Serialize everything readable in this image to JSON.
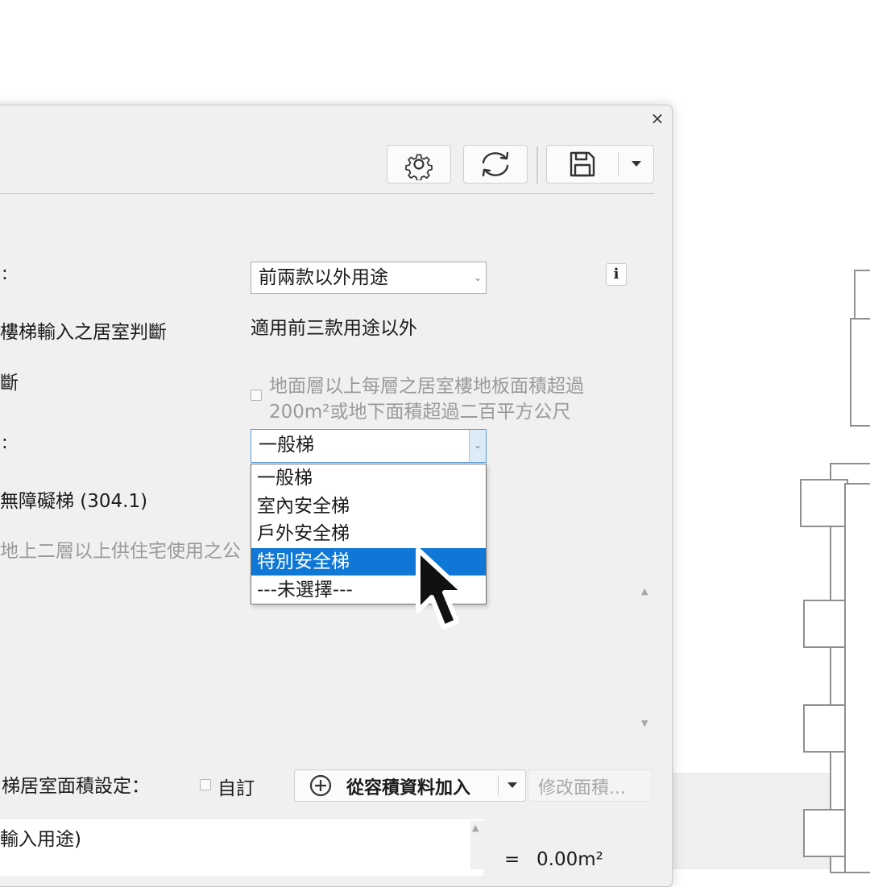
{
  "toolbar": {
    "settings_icon": "gear-icon",
    "refresh_icon": "refresh-icon",
    "save_icon": "save-icon",
    "dropdown_icon": "caret-down-icon",
    "close_label": "×"
  },
  "form": {
    "row1_label": ":",
    "use_select_value": "前兩款以外用途",
    "info_label": "i",
    "row2_label": "樓梯輸入之居室判斷",
    "row2_value": "適用前三款用途以外",
    "row3_label": "斷",
    "area_checkbox_line1": "地面層以上每層之居室樓地板面積超過",
    "area_checkbox_line2": "200m²或地下面積超過二百平方公尺",
    "row4_label": ":",
    "stair_select_value": "一般梯",
    "row5_label": "無障礙梯 (304.1)",
    "row6_label": "地上二層以上供住宅使用之公"
  },
  "dropdown": {
    "options": [
      "一般梯",
      "室內安全梯",
      "戶外安全梯",
      "特別安全梯",
      "---未選擇---"
    ],
    "highlighted_index": 3
  },
  "bottom": {
    "area_setting_label": "梯居室面積設定：",
    "custom_checkbox_label": "自訂",
    "add_from_volume_label": "從容積資料加入",
    "modify_area_label": "修改面積...",
    "lower_list_item": "輸入用途)",
    "total_prefix": "=",
    "total_value": "0.00m²"
  },
  "colors": {
    "dialog_bg": "#f0f0f0",
    "selection_blue": "#0f78d7",
    "select_focus_border": "#5b9bd5"
  }
}
